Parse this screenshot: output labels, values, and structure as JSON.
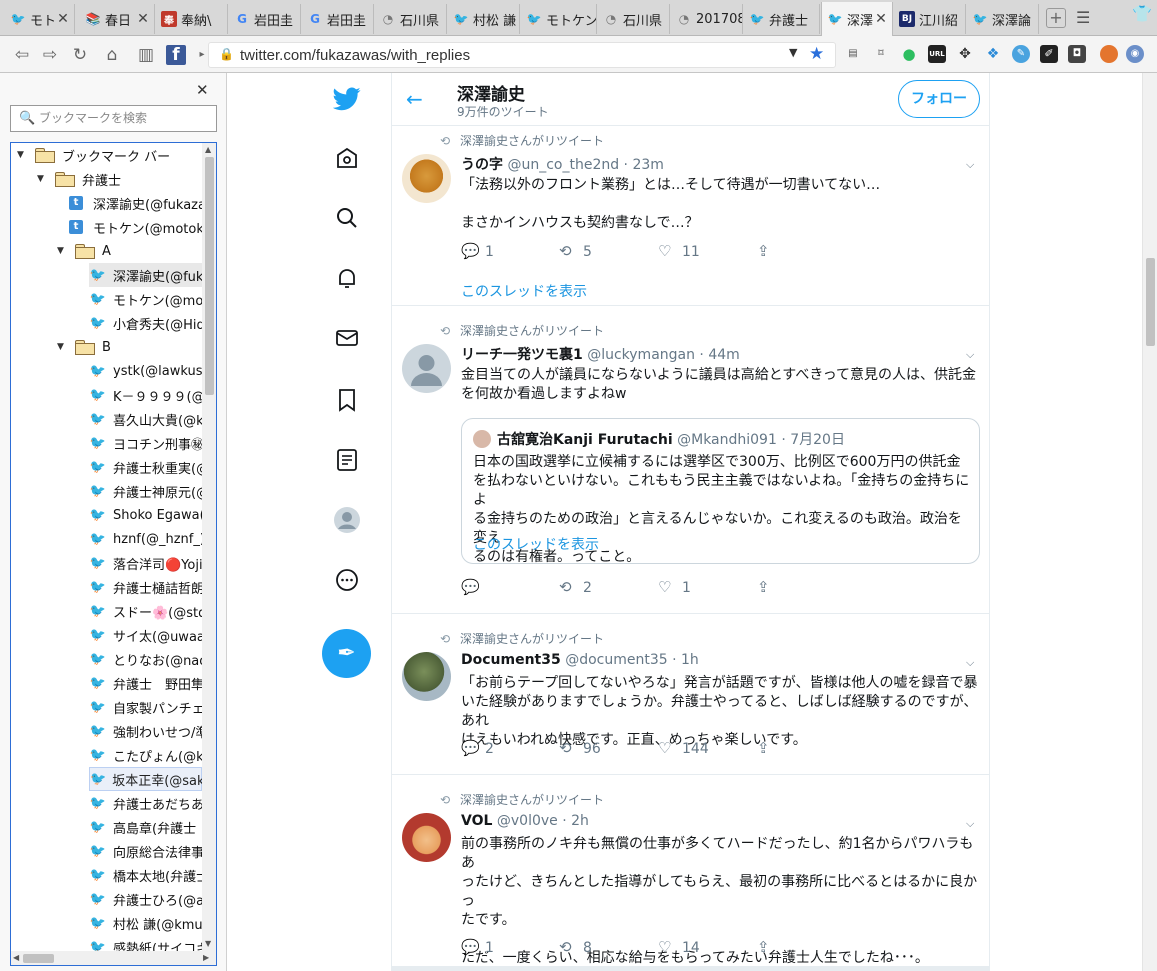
{
  "browser": {
    "tabs": [
      {
        "title": "モト",
        "icon": "twitter-icon"
      },
      {
        "title": "春日",
        "icon": "book-icon"
      },
      {
        "title": "奉納\\",
        "icon": "orange-icon"
      },
      {
        "title": "岩田圭",
        "icon": "google-icon"
      },
      {
        "title": "岩田圭",
        "icon": "google-icon"
      },
      {
        "title": "石川県",
        "icon": "page-icon"
      },
      {
        "title": "村松 謙",
        "icon": "twitter-icon"
      },
      {
        "title": "モトケン",
        "icon": "twitter-icon"
      },
      {
        "title": "石川県",
        "icon": "page-icon"
      },
      {
        "title": "201708",
        "icon": "page-icon"
      },
      {
        "title": "弁護士",
        "icon": "twitter-icon"
      },
      {
        "title": "深澤",
        "icon": "twitter-icon",
        "active": true
      },
      {
        "title": "江川紹",
        "icon": "bj-icon"
      },
      {
        "title": "深澤論",
        "icon": "twitter-icon"
      }
    ],
    "url": "twitter.com/fukazawas/with_replies"
  },
  "sidebar": {
    "search_placeholder": "ブックマークを検索",
    "items": [
      {
        "label": "ブックマーク バー",
        "type": "folder",
        "level": 0
      },
      {
        "label": "弁護士",
        "type": "folder",
        "level": 1
      },
      {
        "label": "深澤諭史(@fukaza",
        "type": "bookmark-square",
        "level": 2
      },
      {
        "label": "モトケン(@motoke",
        "type": "bookmark-square",
        "level": 2
      },
      {
        "label": "A",
        "type": "folder",
        "level": 2
      },
      {
        "label": "深澤諭史(@fuk",
        "type": "bookmark",
        "level": 3,
        "highlight": true
      },
      {
        "label": "モトケン(@moto",
        "type": "bookmark",
        "level": 3
      },
      {
        "label": "小倉秀夫(@Hid",
        "type": "bookmark",
        "level": 3
      },
      {
        "label": "B",
        "type": "folder",
        "level": 2
      },
      {
        "label": "ystk(@lawkus)",
        "type": "bookmark",
        "level": 3
      },
      {
        "label": "K－９９９９(@k9",
        "type": "bookmark",
        "level": 3
      },
      {
        "label": "喜久山大貴(@k",
        "type": "bookmark",
        "level": 3
      },
      {
        "label": "ヨコチン刑事㊙",
        "type": "bookmark",
        "level": 3
      },
      {
        "label": "弁護士秋重実(@",
        "type": "bookmark",
        "level": 3
      },
      {
        "label": "弁護士神原元(@",
        "type": "bookmark",
        "level": 3
      },
      {
        "label": "Shoko Egawa(@",
        "type": "bookmark",
        "level": 3
      },
      {
        "label": "hznf(@_hznf_)",
        "type": "bookmark",
        "level": 3
      },
      {
        "label": "落合洋司🔴Yoji",
        "type": "bookmark",
        "level": 3
      },
      {
        "label": "弁護士樋詰哲朗",
        "type": "bookmark",
        "level": 3
      },
      {
        "label": "スドー🌸(@stda",
        "type": "bookmark",
        "level": 3
      },
      {
        "label": "サイ太(@uwaaa",
        "type": "bookmark",
        "level": 3
      },
      {
        "label": "とりなお(@naot",
        "type": "bookmark",
        "level": 3
      },
      {
        "label": "弁護士　野田隼",
        "type": "bookmark",
        "level": 3
      },
      {
        "label": "自家製パンチェ",
        "type": "bookmark",
        "level": 3
      },
      {
        "label": "強制わいせつ/準",
        "type": "bookmark",
        "level": 3
      },
      {
        "label": "こたぴょん(@ko",
        "type": "bookmark",
        "level": 3
      },
      {
        "label": "坂本正幸(@sak",
        "type": "bookmark",
        "level": 3,
        "selected": true
      },
      {
        "label": "弁護士あだちあ",
        "type": "bookmark",
        "level": 3
      },
      {
        "label": "高島章(弁護士",
        "type": "bookmark",
        "level": 3
      },
      {
        "label": "向原総合法律事",
        "type": "bookmark",
        "level": 3
      },
      {
        "label": "橋本太地(弁護士",
        "type": "bookmark",
        "level": 3
      },
      {
        "label": "弁護士ひろ(@ad",
        "type": "bookmark",
        "level": 3
      },
      {
        "label": "村松 謙(@kmur",
        "type": "bookmark",
        "level": 3
      },
      {
        "label": "感熱紙(サイコキ",
        "type": "bookmark",
        "level": 3
      }
    ]
  },
  "twitter": {
    "header": {
      "name": "深澤諭史",
      "sub": "9万件のツイート",
      "follow": "フォロー"
    },
    "tweets": [
      {
        "rt": "深澤諭史さんがリツイート",
        "name": "うの字",
        "handle": "@un_co_the2nd · 23m",
        "lines": [
          "「法務以外のフロント業務」とは…そして待遇が一切書いてない…",
          "",
          "まさかインハウスも契約書なしで…？"
        ],
        "reply": "1",
        "retweet": "5",
        "like": "11",
        "thread": "このスレッドを表示"
      },
      {
        "rt": "深澤諭史さんがリツイート",
        "name": "リーチ一発ツモ裏1",
        "handle": "@luckymangan · 44m",
        "lines": [
          "金目当ての人が議員にならないように議員は高給とすべきって意見の人は、供託金",
          "を何故か看過しますよねw"
        ],
        "quote": {
          "name": "古舘寛治Kanji Furutachi",
          "handle": "@Mkandhi091 · 7月20日",
          "lines": [
            "日本の国政選挙に立候補するには選挙区で300万、比例区で600万円の供託金",
            "を払わないといけない。これももう民主主義ではないよね。「金持ちの金持ちによ",
            "る金持ちのための政治」と言えるんじゃないか。これ変えるのも政治。政治を変え",
            "るのは有権者。ってこと。"
          ],
          "thread": "このスレッドを表示"
        },
        "reply": "",
        "retweet": "2",
        "like": "1"
      },
      {
        "rt": "深澤諭史さんがリツイート",
        "name": "Document35",
        "handle": "@document35 · 1h",
        "lines": [
          "「お前らテープ回してないやろな」発言が話題ですが、皆様は他人の嘘を録音で暴",
          "いた経験がありますでしょうか。弁護士やってると、しばしば経験するのですが、あれ",
          "はえもいわれぬ快感です。正直、めっちゃ楽しいです。"
        ],
        "reply": "2",
        "retweet": "96",
        "like": "144"
      },
      {
        "rt": "深澤諭史さんがリツイート",
        "name": "VOL",
        "handle": "@v0l0ve · 2h",
        "lines": [
          "前の事務所のノキ弁も無償の仕事が多くてハードだったし、約1名からパワハラもあ",
          "ったけど、きちんとした指導がしてもらえ、最初の事務所に比べるとはるかに良かっ",
          "たです。",
          "",
          "ただ、一度くらい、相応な給与をもらってみたい弁護士人生でしたね･･･。"
        ],
        "reply": "1",
        "retweet": "8",
        "like": "14"
      }
    ]
  },
  "colors": {
    "accent": "#1da1f2",
    "text": "#14171a",
    "muted": "#657786"
  }
}
